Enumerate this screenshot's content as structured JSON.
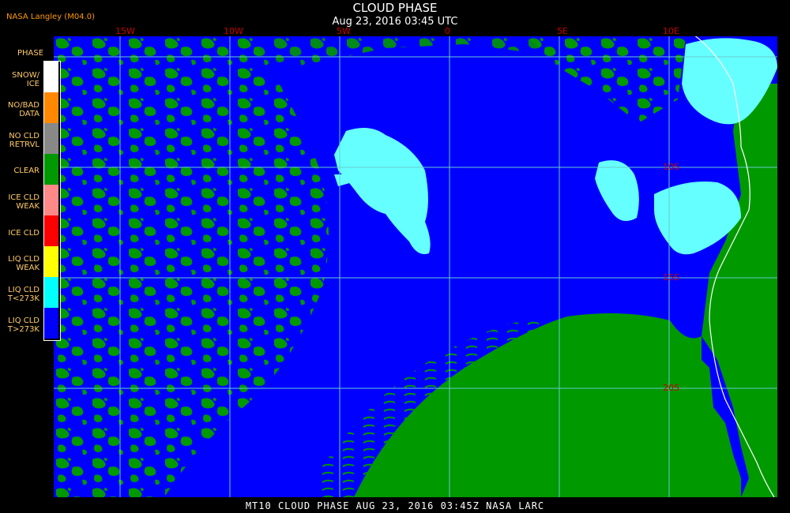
{
  "header": {
    "title": "CLOUD PHASE",
    "subtitle": "Aug 23, 2016 03:45 UTC",
    "product": "NASA Langley (M04.0)"
  },
  "map": {
    "lon_labels": [
      "15W",
      "10W",
      "5W",
      "0",
      "5E",
      "10E"
    ],
    "lat_labels": [
      "10S",
      "15S",
      "20S"
    ],
    "colors": {
      "ocean": "#0000ff",
      "clear": "#009900",
      "ice": "#66ffff",
      "grid": "#66cccc",
      "coast": "#ffffff"
    }
  },
  "legend": {
    "title": "PHASE",
    "items": [
      {
        "label1": "SNOW/",
        "label2": "ICE",
        "color": "#ffffff"
      },
      {
        "label1": "NO/BAD",
        "label2": "DATA",
        "color": "#ff8800"
      },
      {
        "label1": "NO CLD",
        "label2": "RETRVL",
        "color": "#888888"
      },
      {
        "label1": "CLEAR",
        "label2": "",
        "color": "#009900"
      },
      {
        "label1": "ICE CLD",
        "label2": "WEAK",
        "color": "#ff8888"
      },
      {
        "label1": "ICE CLD",
        "label2": "",
        "color": "#ff0000"
      },
      {
        "label1": "LIQ CLD",
        "label2": "WEAK",
        "color": "#ffff00"
      },
      {
        "label1": "LIQ CLD",
        "label2": "T<273K",
        "color": "#00ffff"
      },
      {
        "label1": "LIQ CLD",
        "label2": "T>273K",
        "color": "#0000ff"
      }
    ]
  },
  "footer": {
    "text": "MT10  CLOUD PHASE  AUG 23, 2016 03:45Z  NASA LARC"
  }
}
